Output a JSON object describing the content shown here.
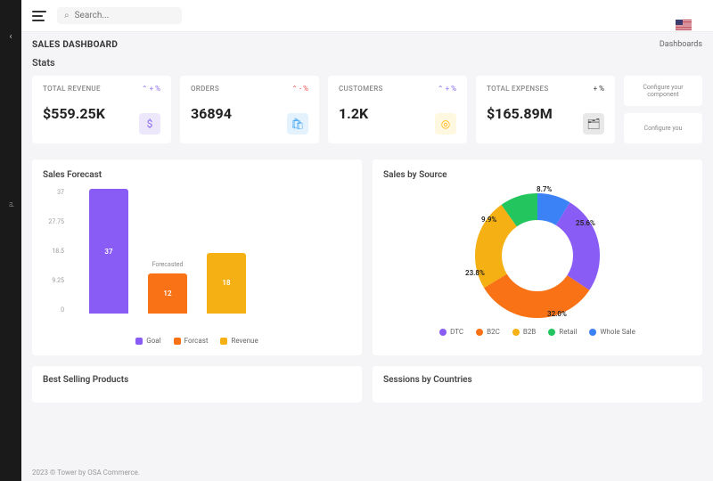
{
  "search": {
    "placeholder": "Search..."
  },
  "page": {
    "title": "SALES DASHBOARD",
    "breadcrumb": "Dashboards"
  },
  "stats_header": "Stats",
  "stats": [
    {
      "label": "TOTAL REVENUE",
      "value": "$559.25K",
      "trend": "⌃ + %",
      "trend_dir": "up",
      "icon": "$",
      "icon_color": "purple",
      "icon_name": "dollar-icon"
    },
    {
      "label": "ORDERS",
      "value": "36894",
      "trend": "⌃ - %",
      "trend_dir": "down",
      "icon": "🛍",
      "icon_color": "blue",
      "icon_name": "bag-icon"
    },
    {
      "label": "CUSTOMERS",
      "value": "1.2K",
      "trend": "⌃ + %",
      "trend_dir": "up",
      "icon": "◎",
      "icon_color": "yellow",
      "icon_name": "user-icon"
    },
    {
      "label": "TOTAL EXPENSES",
      "value": "$165.89M",
      "trend": "+ %",
      "trend_dir": "",
      "icon": "🗂",
      "icon_color": "grey",
      "icon_name": "wallet-icon"
    }
  ],
  "config_box1": "Configure your component",
  "config_box2": "Configure you",
  "forecast_title": "Sales Forecast",
  "forecast_legend": {
    "goal": "Goal",
    "forecast": "Forcast",
    "revenue": "Revenue"
  },
  "forecast_annotation": "Forecasted",
  "source_title": "Sales by Source",
  "source_legend": [
    "DTC",
    "B2C",
    "B2B",
    "Retail",
    "Whole Sale"
  ],
  "bottom": {
    "left": "Best Selling Products",
    "right": "Sessions by Countries"
  },
  "footer": "2023 © Tower by OSA Commerce.",
  "chart_data": [
    {
      "type": "bar",
      "title": "Sales Forecast",
      "categories": [
        "Goal",
        "Forcast",
        "Revenue"
      ],
      "values": [
        37,
        12,
        18
      ],
      "ylabel": "",
      "xlabel": "",
      "ylim": [
        0,
        37
      ],
      "y_ticks": [
        0,
        9.25,
        18.5,
        27.75,
        37
      ],
      "colors": [
        "#8a5cf6",
        "#f97316",
        "#f5b014"
      ],
      "annotations": [
        {
          "text": "Forecasted",
          "on": "Forcast"
        }
      ]
    },
    {
      "type": "pie",
      "title": "Sales by Source",
      "series": [
        {
          "name": "DTC",
          "value": 25.6,
          "color": "#8a5cf6"
        },
        {
          "name": "B2C",
          "value": 32.0,
          "color": "#f97316"
        },
        {
          "name": "B2B",
          "value": 23.8,
          "color": "#f5b014"
        },
        {
          "name": "Retail",
          "value": 9.9,
          "color": "#22c55e"
        },
        {
          "name": "Whole Sale",
          "value": 8.7,
          "color": "#3b82f6"
        }
      ],
      "donut": true
    }
  ]
}
